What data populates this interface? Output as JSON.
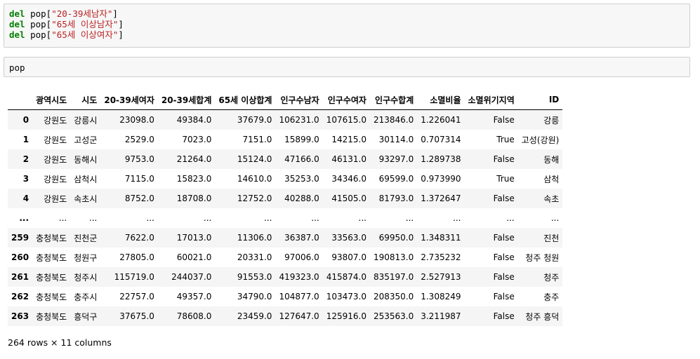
{
  "cells": {
    "code1": {
      "lines": [
        {
          "kw": "del",
          "pre": " pop[",
          "str": "\"20-39세남자\"",
          "post": "]"
        },
        {
          "kw": "del",
          "pre": " pop[",
          "str": "\"65세 이상남자\"",
          "post": "]"
        },
        {
          "kw": "del",
          "pre": " pop[",
          "str": "\"65세 이상여자\"",
          "post": "]"
        }
      ]
    },
    "code2": {
      "text": "pop"
    }
  },
  "dataframe": {
    "columns": [
      "",
      "광역시도",
      "시도",
      "20-39세여자",
      "20-39세합계",
      "65세 이상합계",
      "인구수남자",
      "인구수여자",
      "인구수합계",
      "소멸비율",
      "소멸위기지역",
      "ID"
    ],
    "rows": [
      [
        "0",
        "강원도",
        "강릉시",
        "23098.0",
        "49384.0",
        "37679.0",
        "106231.0",
        "107615.0",
        "213846.0",
        "1.226041",
        "False",
        "강릉"
      ],
      [
        "1",
        "강원도",
        "고성군",
        "2529.0",
        "7023.0",
        "7151.0",
        "15899.0",
        "14215.0",
        "30114.0",
        "0.707314",
        "True",
        "고성(강원)"
      ],
      [
        "2",
        "강원도",
        "동해시",
        "9753.0",
        "21264.0",
        "15124.0",
        "47166.0",
        "46131.0",
        "93297.0",
        "1.289738",
        "False",
        "동해"
      ],
      [
        "3",
        "강원도",
        "삼척시",
        "7115.0",
        "15823.0",
        "14610.0",
        "35253.0",
        "34346.0",
        "69599.0",
        "0.973990",
        "True",
        "삼척"
      ],
      [
        "4",
        "강원도",
        "속초시",
        "8752.0",
        "18708.0",
        "12752.0",
        "40288.0",
        "41505.0",
        "81793.0",
        "1.372647",
        "False",
        "속초"
      ],
      [
        "...",
        "...",
        "...",
        "...",
        "...",
        "...",
        "...",
        "...",
        "...",
        "...",
        "...",
        "..."
      ],
      [
        "259",
        "충청북도",
        "진천군",
        "7622.0",
        "17013.0",
        "11306.0",
        "36387.0",
        "33563.0",
        "69950.0",
        "1.348311",
        "False",
        "진천"
      ],
      [
        "260",
        "충청북도",
        "청원구",
        "27805.0",
        "60021.0",
        "20331.0",
        "97006.0",
        "93807.0",
        "190813.0",
        "2.735232",
        "False",
        "청주 청원"
      ],
      [
        "261",
        "충청북도",
        "청주시",
        "115719.0",
        "244037.0",
        "91553.0",
        "419323.0",
        "415874.0",
        "835197.0",
        "2.527913",
        "False",
        "청주"
      ],
      [
        "262",
        "충청북도",
        "충주시",
        "22757.0",
        "49357.0",
        "34790.0",
        "104877.0",
        "103473.0",
        "208350.0",
        "1.308249",
        "False",
        "충주"
      ],
      [
        "263",
        "충청북도",
        "흥덕구",
        "37675.0",
        "78608.0",
        "23459.0",
        "127647.0",
        "125916.0",
        "253563.0",
        "3.211987",
        "False",
        "청주 흥덕"
      ]
    ],
    "footer": "264 rows × 11 columns"
  }
}
